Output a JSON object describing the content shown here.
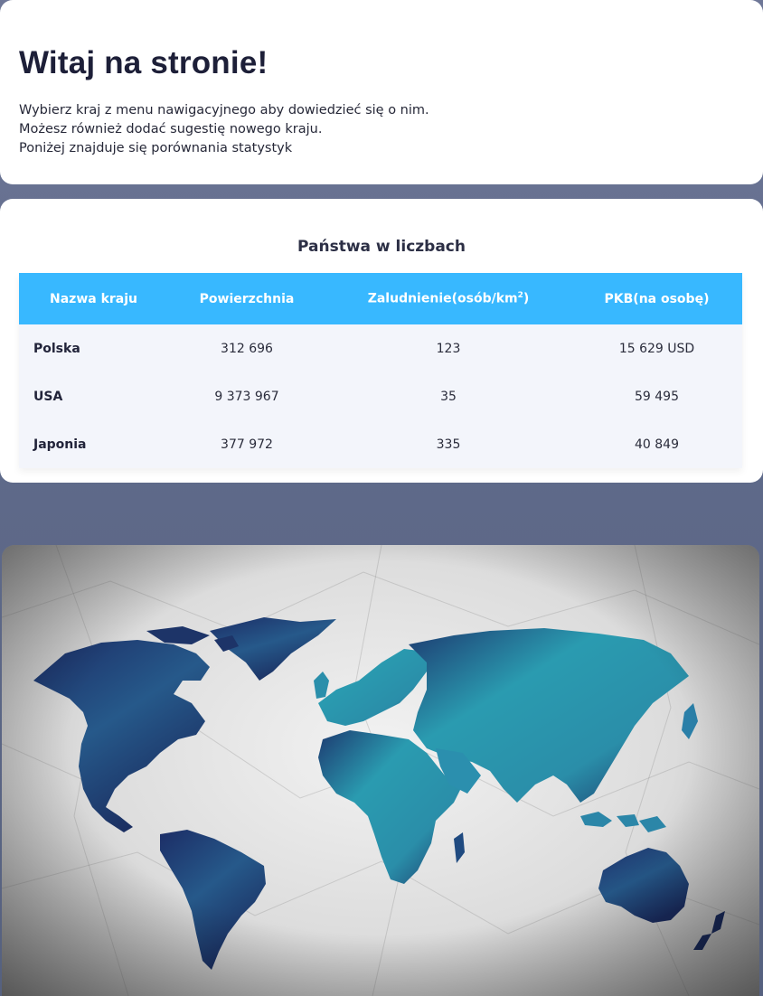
{
  "welcome": {
    "title": "Witaj na stronie!",
    "lines": [
      "Wybierz kraj z menu nawigacyjnego aby dowiedzieć się o nim.",
      "Możesz również dodać sugestię nowego kraju.",
      "Poniżej znajduje się porównania statystyk"
    ]
  },
  "stats": {
    "title": "Państwa w liczbach",
    "headers": {
      "name": "Nazwa kraju",
      "area": "Powierzchnia",
      "density": "Zaludnienie(osób/km",
      "density_sup": "2",
      "density_close": ")",
      "gdp": "PKB(na osobę)"
    },
    "rows": [
      {
        "country": "Polska",
        "area": "312 696",
        "density": "123",
        "gdp": "15 629 USD"
      },
      {
        "country": "USA",
        "area": "9 373 967",
        "density": "35",
        "gdp": "59 495"
      },
      {
        "country": "Japonia",
        "area": "377 972",
        "density": "335",
        "gdp": "40 849"
      }
    ]
  },
  "image": {
    "subject": "crumpled paper world map",
    "colors": {
      "land_light": "#2a9bb0",
      "land_dark": "#1a2f63",
      "paper": "#e4e4e4"
    }
  }
}
